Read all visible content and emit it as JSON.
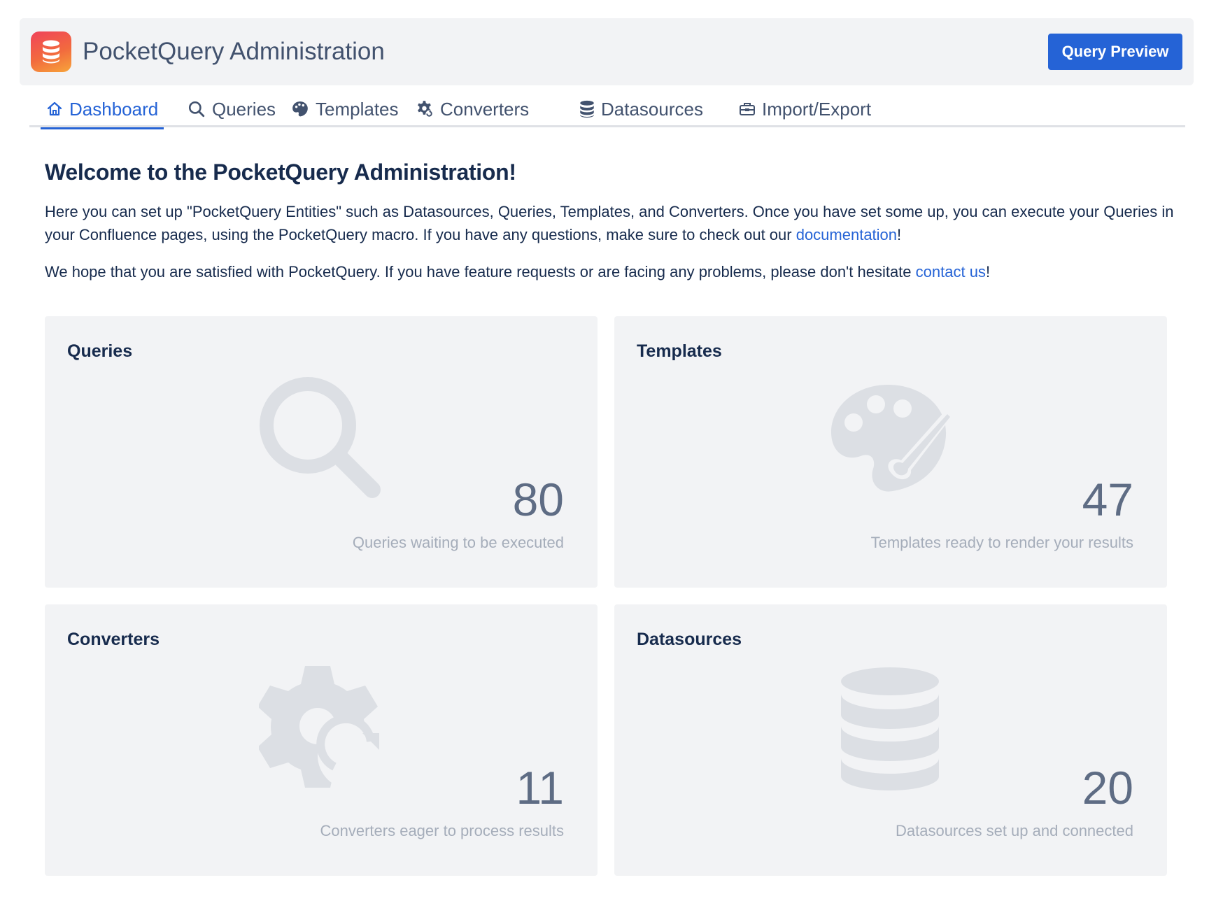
{
  "header": {
    "title": "PocketQuery Administration",
    "logo_icon": "database-icon",
    "preview_button": "Query Preview"
  },
  "tabs": [
    {
      "label": "Dashboard",
      "icon": "home-icon",
      "active": true
    },
    {
      "label": "Queries",
      "icon": "search-icon",
      "active": false
    },
    {
      "label": "Templates",
      "icon": "palette-icon",
      "active": false
    },
    {
      "label": "Converters",
      "icon": "gear-refresh-icon",
      "active": false
    },
    {
      "label": "Datasources",
      "icon": "database-icon",
      "active": false
    },
    {
      "label": "Import/Export",
      "icon": "toolbox-icon",
      "active": false
    }
  ],
  "intro": {
    "heading": "Welcome to the PocketQuery Administration!",
    "p1_text": "Here you can set up \"PocketQuery Entities\" such as Datasources, Queries, Templates, and Converters. Once you have set some up, you can execute your Queries in your Confluence pages, using the PocketQuery macro. If you have any questions, make sure to check out our ",
    "p1_link": "documentation",
    "p1_end": "!",
    "p2_text": "We hope that you are satisfied with PocketQuery. If you have feature requests or are facing any problems, please don't hesitate ",
    "p2_link": "contact us",
    "p2_end": "!"
  },
  "cards": [
    {
      "title": "Queries",
      "count": "80",
      "caption": "Queries waiting to be executed",
      "icon": "search-icon"
    },
    {
      "title": "Templates",
      "count": "47",
      "caption": "Templates ready to render your results",
      "icon": "palette-icon"
    },
    {
      "title": "Converters",
      "count": "11",
      "caption": "Converters eager to process results",
      "icon": "gear-refresh-icon"
    },
    {
      "title": "Datasources",
      "count": "20",
      "caption": "Datasources set up and connected",
      "icon": "database-icon"
    }
  ],
  "colors": {
    "accent": "#2563d6",
    "card_bg": "#f2f3f5",
    "icon_watermark": "#dcdfe4"
  }
}
